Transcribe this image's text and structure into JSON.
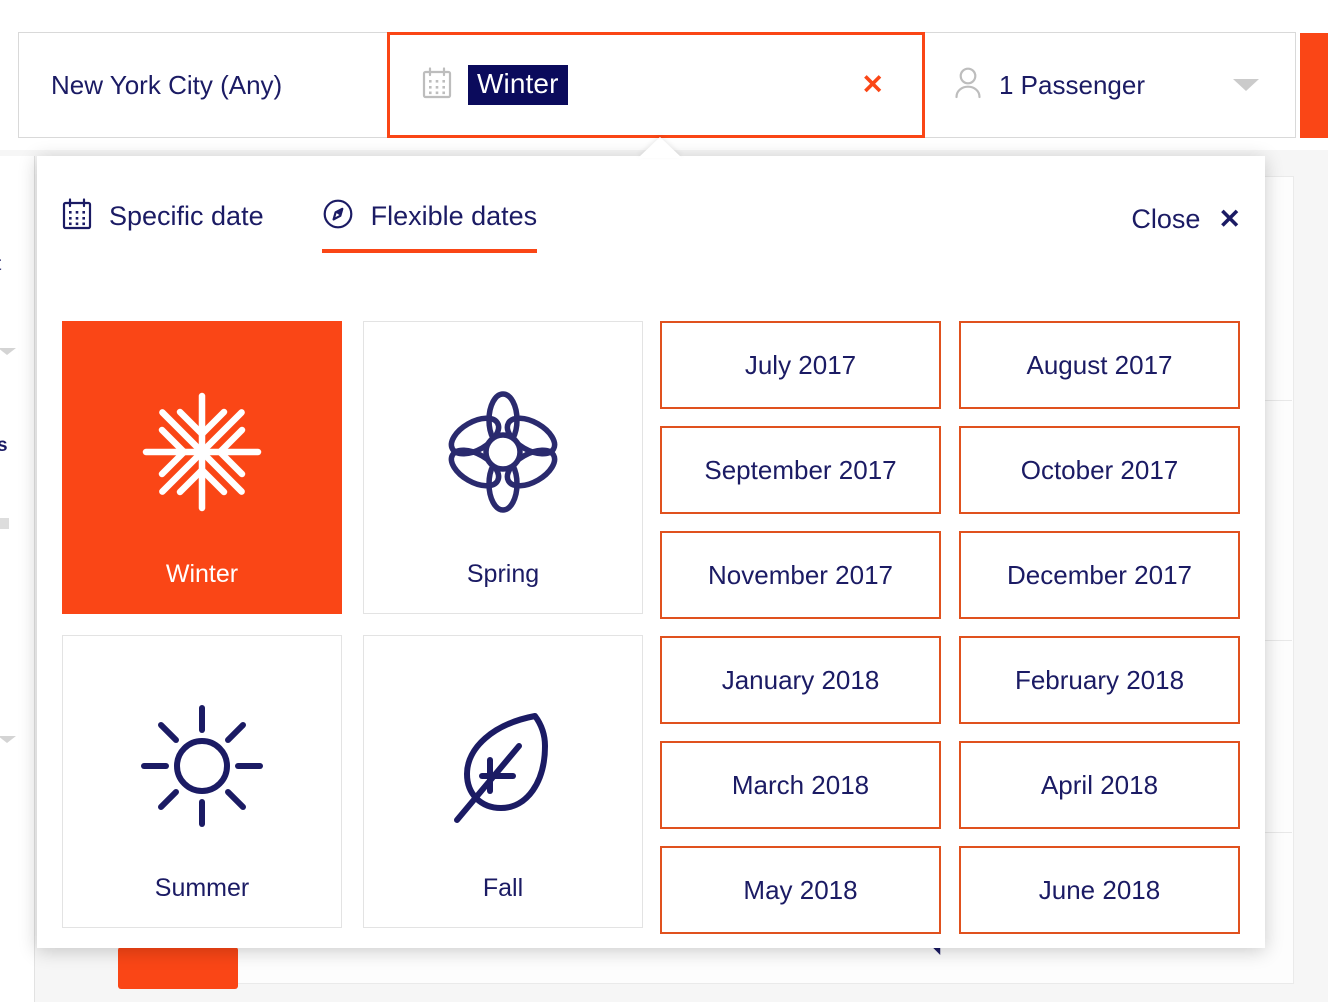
{
  "theme": {
    "accent_orange": "#fa4616",
    "month_border_orange": "#e0511e",
    "navy": "#1b1b64",
    "selection_navy": "#0b0b5c"
  },
  "searchbar": {
    "origin": {
      "value": "New York City (Any)",
      "icon": ""
    },
    "date": {
      "icon": "calendar-icon",
      "value": "Winter",
      "selected": true,
      "clear_icon": "✕"
    },
    "passengers": {
      "icon": "person-icon",
      "value": "1 Passenger",
      "caret_icon": "chevron-down-icon"
    },
    "search_button": {
      "label": "",
      "icon": "search-icon"
    }
  },
  "popup": {
    "tabs": [
      {
        "label": "Specific date",
        "icon": "calendar-icon",
        "active": false
      },
      {
        "label": "Flexible dates",
        "icon": "compass-icon",
        "active": true
      }
    ],
    "close": {
      "label": "Close",
      "icon": "close-icon"
    },
    "seasons": [
      {
        "label": "Winter",
        "icon": "snowflake-icon",
        "selected": true
      },
      {
        "label": "Spring",
        "icon": "flower-icon",
        "selected": false
      },
      {
        "label": "Summer",
        "icon": "sun-icon",
        "selected": false
      },
      {
        "label": "Fall",
        "icon": "leaf-icon",
        "selected": false
      }
    ],
    "months": [
      "July 2017",
      "August 2017",
      "September 2017",
      "October 2017",
      "November 2017",
      "December 2017",
      "January 2018",
      "February 2018",
      "March 2018",
      "April 2018",
      "May 2018",
      "June 2018"
    ]
  },
  "background": {
    "fragments": [
      {
        "text": "t",
        "bold": false
      },
      {
        "text": "s",
        "bold": true
      }
    ]
  }
}
